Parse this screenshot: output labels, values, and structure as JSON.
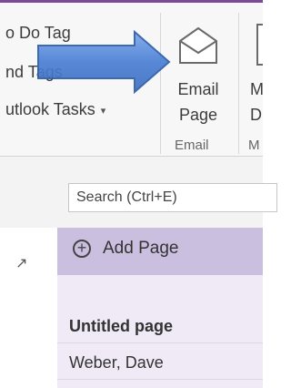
{
  "ribbon": {
    "tags_items": [
      "o Do Tag",
      "nd Tags",
      "utlook Tasks"
    ],
    "email_page_line1": "Email",
    "email_page_line2": "Page",
    "email_group_label": "Email",
    "next_button_line1": "M",
    "next_button_line2": "D",
    "next_group_label": "M"
  },
  "search": {
    "placeholder": "Search (Ctrl+E)"
  },
  "pages": {
    "add_page_label": "Add Page",
    "items": [
      {
        "title": "Untitled page"
      },
      {
        "title": "Weber, Dave"
      }
    ]
  },
  "colors": {
    "accent_purple": "#7d4b96",
    "add_page_bg": "#cbbfe0",
    "arrow_blue": "#4a7fd4"
  },
  "icons": [
    "envelope-icon",
    "dropdown-caret-icon",
    "add-page-plus-icon",
    "popout-icon",
    "callout-arrow-icon"
  ]
}
